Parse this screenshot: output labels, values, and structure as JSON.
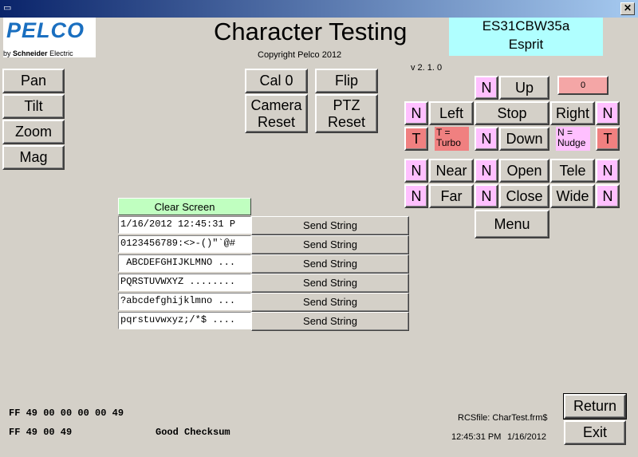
{
  "window": {
    "close_label": "✕"
  },
  "logo": {
    "brand": "PELCO",
    "by": "by",
    "company": "Schneider",
    "company2": "Electric"
  },
  "header": {
    "title": "Character Testing",
    "copyright": "Copyright Pelco 2012",
    "version": "v 2. 1. 0"
  },
  "device": {
    "model": "ES31CBW35a",
    "name": "Esprit"
  },
  "left_buttons": [
    "Pan",
    "Tilt",
    "Zoom",
    "Mag"
  ],
  "center_buttons": {
    "cal0": "Cal 0",
    "flip": "Flip",
    "camera_reset": "Camera\nReset",
    "ptz_reset": "PTZ\nReset"
  },
  "ptz": {
    "counter": "0",
    "up": "Up",
    "left": "Left",
    "stop": "Stop",
    "right": "Right",
    "down": "Down",
    "n": "N",
    "t": "T",
    "turbo_legend": "T =\nTurbo",
    "nudge_legend": "N =\nNudge",
    "near": "Near",
    "far": "Far",
    "open": "Open",
    "close": "Close",
    "tele": "Tele",
    "wide": "Wide",
    "menu": "Menu"
  },
  "strings": {
    "clear_label": "Clear Screen",
    "send_label": "Send String",
    "rows": [
      "1/16/2012 12:45:31 P",
      "0123456789:<>-()\"`@#",
      " ABCDEFGHIJKLMNO ...",
      "PQRSTUVWXYZ ........",
      "?abcdefghijklmno ...",
      "pqrstuvwxyz;/*$ ...."
    ]
  },
  "status": {
    "sent": "FF 49 00 00 00 00 49",
    "received": "FF 49 00 49",
    "checksum": "Good Checksum",
    "rcsfile": "RCSfile: CharTest.frm$",
    "time": "12:45:31 PM",
    "date": "1/16/2012"
  },
  "footer_buttons": {
    "return": "Return",
    "exit": "Exit"
  },
  "colors": {
    "device_box": "#b0ffff",
    "clear_button": "#c0ffc0",
    "nudge": "#ffc0ff",
    "turbo": "#f08080"
  }
}
